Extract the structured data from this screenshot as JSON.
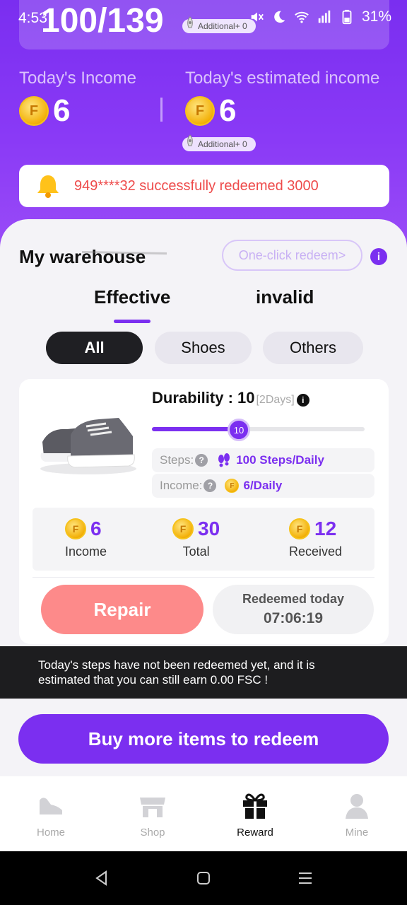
{
  "status_bar": {
    "time": "4:53",
    "steps_overlay": "100/139",
    "battery": "31%",
    "additional_top": "Additional+ 0"
  },
  "income": {
    "today_label": "Today's Income",
    "today_value": "6",
    "estimated_label": "Today's estimated income",
    "estimated_value": "6",
    "additional": "Additional+ 0",
    "coin_glyph": "F"
  },
  "notice": {
    "text": "949****32 successfully redeemed 3000",
    "color": "#ee4b4b"
  },
  "warehouse": {
    "title": "My warehouse",
    "one_click": "One-click redeem>",
    "info": "i",
    "tabs": [
      {
        "label": "Effective",
        "active": true
      },
      {
        "label": "invalid",
        "active": false
      }
    ],
    "filters": [
      {
        "label": "All",
        "active": true
      },
      {
        "label": "Shoes",
        "active": false
      },
      {
        "label": "Others",
        "active": false
      }
    ]
  },
  "item": {
    "durability_label": "Durability : 10",
    "durability_days": "[2Days]",
    "durability_level": 10,
    "durability_fraction": 0.41,
    "steps_label": "Steps:",
    "steps_value": "100 Steps/Daily",
    "income_label": "Income:",
    "income_value": "6/Daily",
    "stats": [
      {
        "value": "6",
        "label": "Income"
      },
      {
        "value": "30",
        "label": "Total"
      },
      {
        "value": "12",
        "label": "Received"
      }
    ],
    "repair_label": "Repair",
    "redeemed_label": "Redeemed today",
    "redeemed_time": "07:06:19"
  },
  "toast": {
    "line1": "Today's steps have not been redeemed yet, and it is",
    "line2": "estimated that you can still earn 0.00 FSC !"
  },
  "buy_button": "Buy more items to redeem",
  "nav": [
    {
      "label": "Home",
      "icon": "shoe-icon",
      "active": false
    },
    {
      "label": "Shop",
      "icon": "shop-icon",
      "active": false
    },
    {
      "label": "Reward",
      "icon": "gift-icon",
      "active": true
    },
    {
      "label": "Mine",
      "icon": "user-icon",
      "active": false
    }
  ],
  "colors": {
    "accent": "#7b2ff0",
    "repair": "#fd8a8a",
    "header": "#8a3af6"
  }
}
